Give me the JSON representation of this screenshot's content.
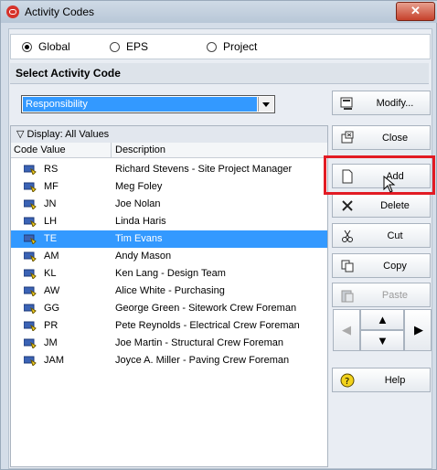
{
  "window": {
    "title": "Activity Codes"
  },
  "scope": {
    "options": [
      "Global",
      "EPS",
      "Project"
    ],
    "selected": "Global"
  },
  "section_title": "Select Activity Code",
  "code_type": {
    "selected": "Responsibility"
  },
  "buttons": {
    "modify": "Modify...",
    "close": "Close",
    "add": "Add",
    "delete": "Delete",
    "cut": "Cut",
    "copy": "Copy",
    "paste": "Paste",
    "help": "Help"
  },
  "list": {
    "display_label": "Display: All Values",
    "columns": [
      "Code Value",
      "Description"
    ],
    "rows": [
      {
        "code": "RS",
        "desc": "Richard Stevens - Site Project Manager"
      },
      {
        "code": "MF",
        "desc": "Meg Foley"
      },
      {
        "code": "JN",
        "desc": "Joe Nolan"
      },
      {
        "code": "LH",
        "desc": "Linda Haris"
      },
      {
        "code": "TE",
        "desc": "Tim Evans",
        "selected": true
      },
      {
        "code": "AM",
        "desc": "Andy Mason"
      },
      {
        "code": "KL",
        "desc": "Ken Lang - Design Team"
      },
      {
        "code": "AW",
        "desc": "Alice White - Purchasing"
      },
      {
        "code": "GG",
        "desc": "George Green - Sitework Crew Foreman"
      },
      {
        "code": "PR",
        "desc": "Pete Reynolds - Electrical Crew Foreman"
      },
      {
        "code": "JM",
        "desc": "Joe Martin - Structural Crew Foreman"
      },
      {
        "code": "JAM",
        "desc": "Joyce A. Miller - Paving Crew Foreman"
      }
    ]
  },
  "colors": {
    "selection": "#3399ff",
    "highlight_box": "#e21b24",
    "close_button": "#c6412b"
  },
  "icons": {
    "app": "oracle-icon",
    "modify": "modify-icon",
    "close": "close-window-icon",
    "add": "new-document-icon",
    "delete": "delete-x-icon",
    "cut": "scissors-icon",
    "copy": "copy-icon",
    "paste": "paste-icon",
    "help": "help-icon"
  }
}
